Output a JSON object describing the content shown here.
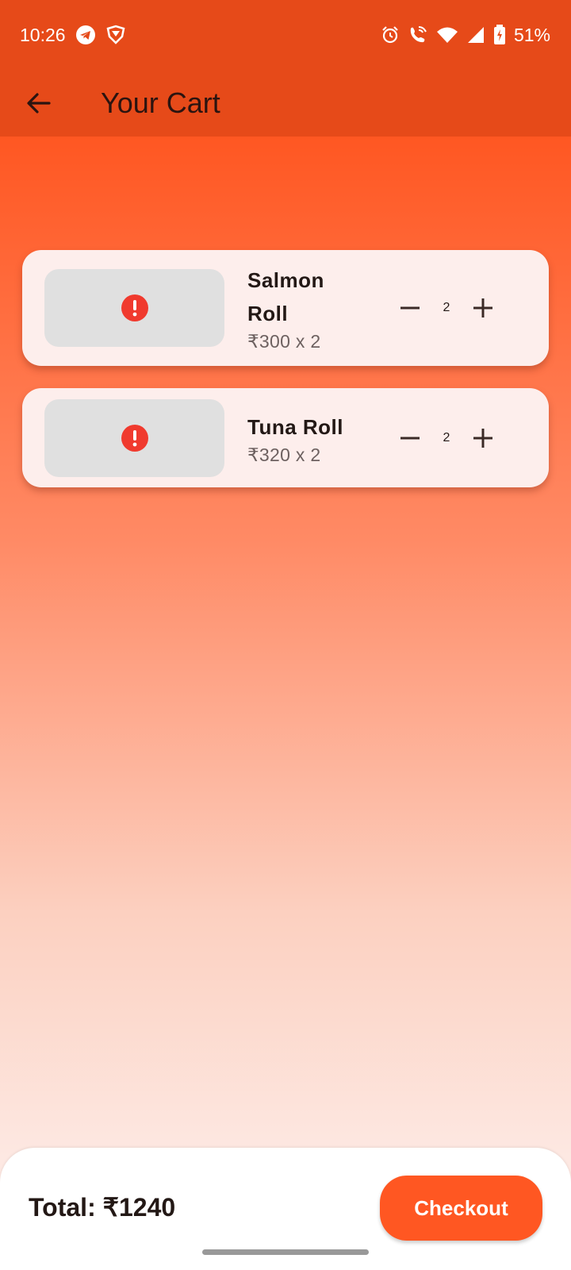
{
  "status_bar": {
    "time": "10:26",
    "left_icons": [
      "telegram-icon",
      "vpn-shield-icon"
    ],
    "right_icons": [
      "alarm-icon",
      "wifi-calling-icon",
      "wifi-icon",
      "signal-icon",
      "battery-charging-icon"
    ],
    "battery": "51%"
  },
  "app_bar": {
    "title": "Your Cart",
    "back_icon": "arrow-back-icon",
    "color": "#e64a19"
  },
  "cart": {
    "items": [
      {
        "name": "Salmon Roll",
        "name_line1": "Salmon",
        "name_line2": "Roll",
        "price": "₹300 x 2",
        "quantity": "2",
        "image_icon": "error-icon"
      },
      {
        "name": "Tuna Roll",
        "price": "₹320 x 2",
        "quantity": "2",
        "image_icon": "error-icon"
      }
    ]
  },
  "footer": {
    "total": "Total: ₹1240",
    "checkout_label": "Checkout",
    "accent": "#ff5722"
  }
}
